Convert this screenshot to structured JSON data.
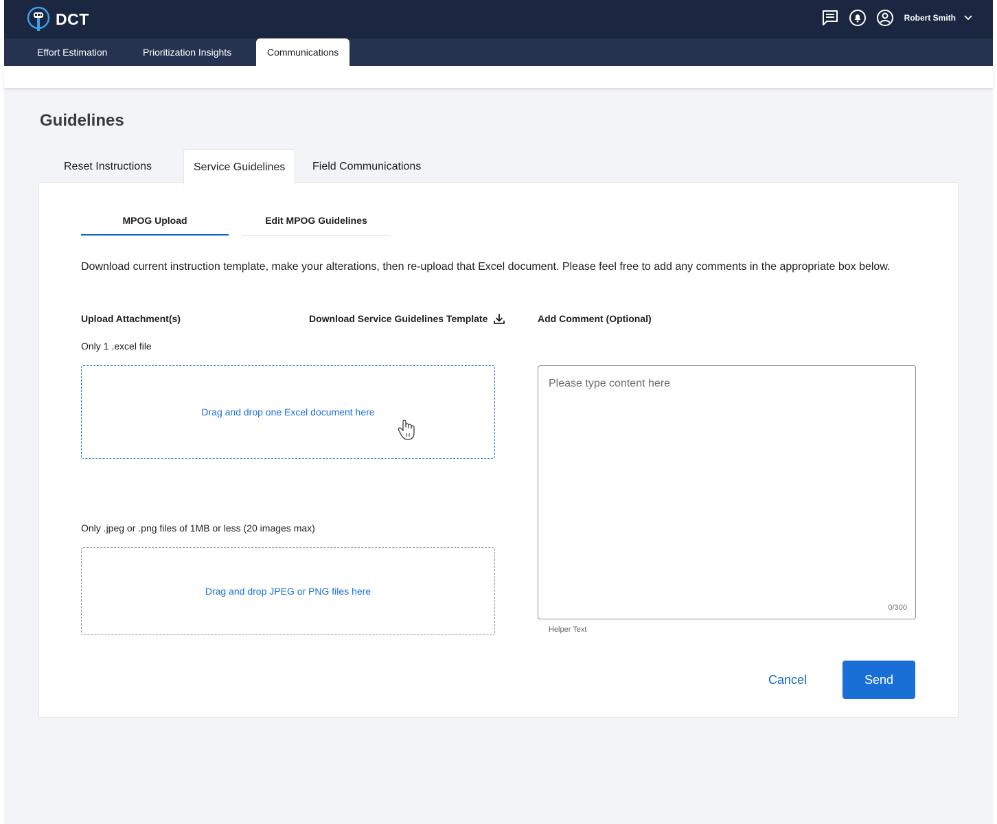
{
  "app": {
    "logo_text": "DCT"
  },
  "header": {
    "user_name": "Robert Smith",
    "icons": [
      "chat-icon",
      "bell-icon",
      "account-circle-icon",
      "chevron-down-icon"
    ]
  },
  "nav": {
    "tabs": [
      {
        "label": "Effort Estimation",
        "active": false
      },
      {
        "label": "Prioritization Insights",
        "active": false
      },
      {
        "label": "Communications",
        "active": true
      }
    ]
  },
  "page": {
    "title": "Guidelines"
  },
  "section_tabs": [
    {
      "label": "Reset Instructions",
      "active": false
    },
    {
      "label": "Service Guidelines",
      "active": true
    },
    {
      "label": "Field Communications",
      "active": false
    }
  ],
  "sub_tabs": [
    {
      "label": "MPOG Upload",
      "active": true
    },
    {
      "label": "Edit MPOG Guidelines",
      "active": false
    }
  ],
  "intro_text": "Download current instruction template, make your alterations, then re-upload that Excel document. Please feel free to add any comments in the appropriate box below.",
  "upload": {
    "label": "Upload Attachment(s)",
    "excel_hint": "Only 1 .excel file",
    "excel_drop_text": "Drag and drop one Excel document here",
    "images_hint": "Only .jpeg or .png files of 1MB or less (20 images max)",
    "images_drop_text": "Drag and drop JPEG or PNG files here"
  },
  "download": {
    "label": "Download Service Guidelines Template"
  },
  "comment": {
    "label": "Add Comment (Optional)",
    "placeholder": "Please type content here",
    "value": "",
    "counter": "0/300",
    "helper": "Helper Text"
  },
  "actions": {
    "cancel_label": "Cancel",
    "send_label": "Send"
  },
  "colors": {
    "topbar": "#1b2740",
    "navbar": "#253351",
    "accent": "#1a6fd6",
    "page_bg": "#f3f4f7"
  }
}
